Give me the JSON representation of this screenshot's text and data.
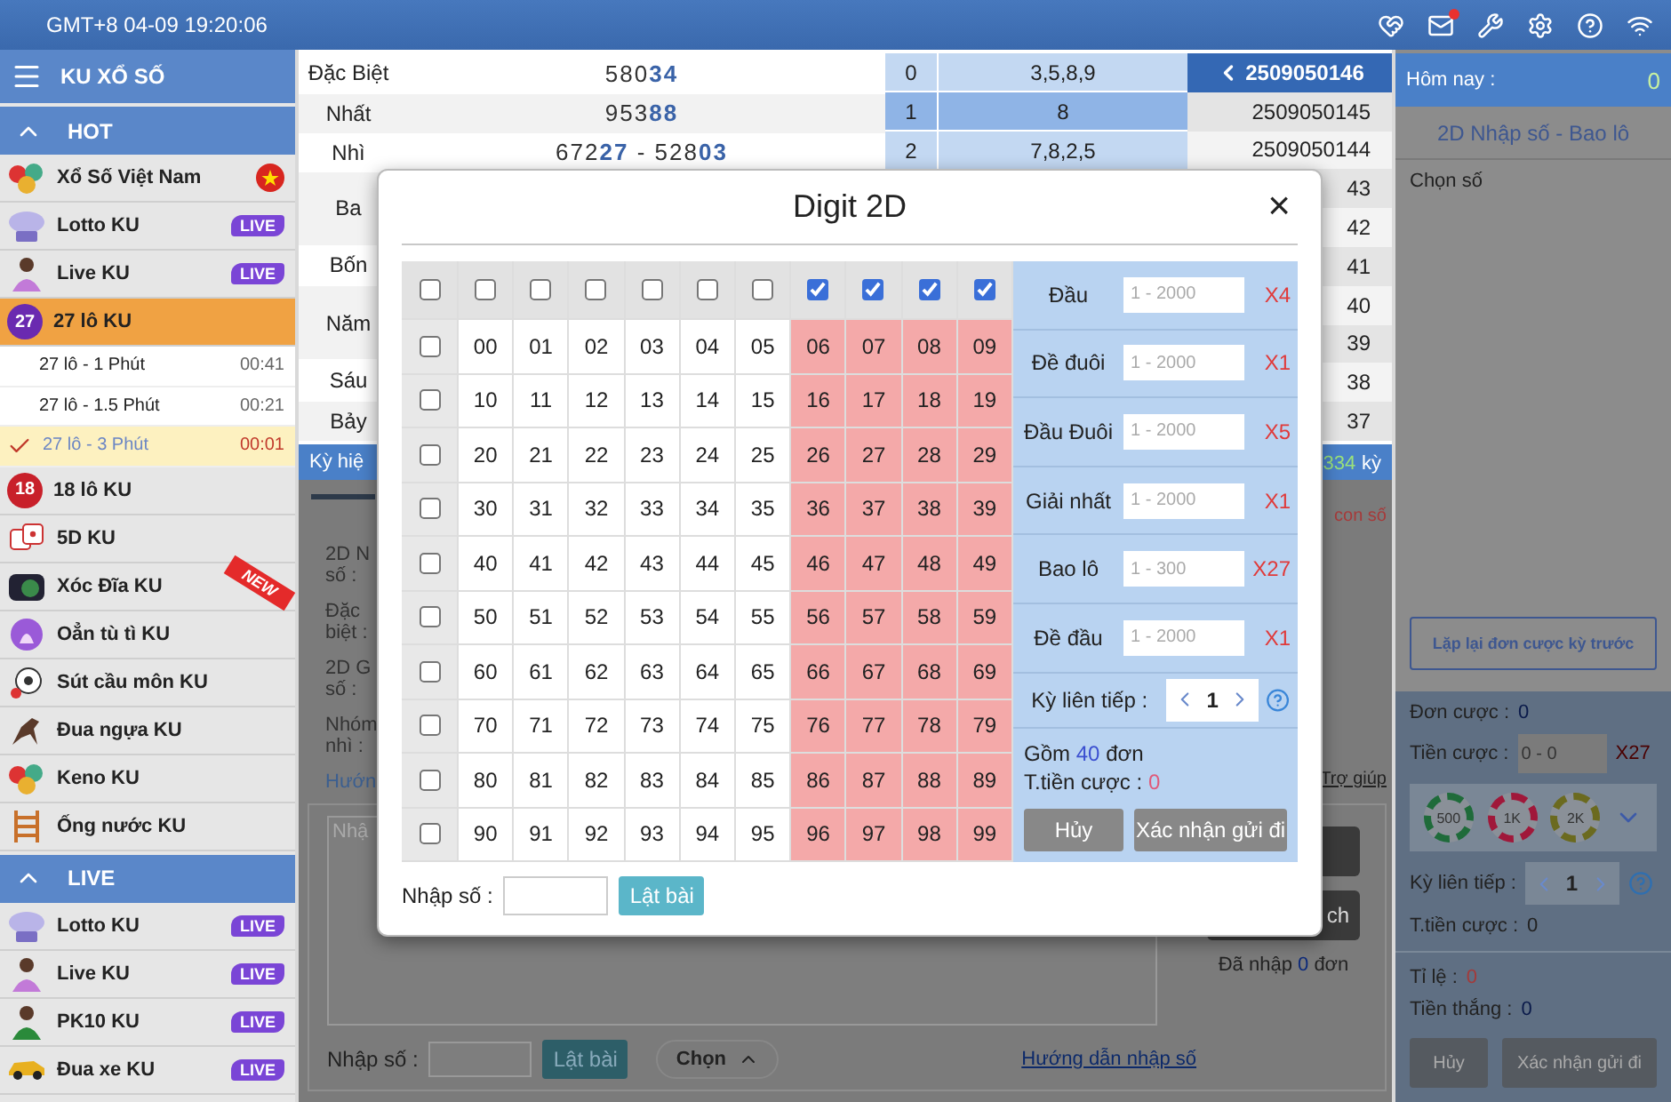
{
  "top_bar": {
    "clock": "GMT+8 04-09 19:20:06",
    "mail_unread": true
  },
  "sidebar": {
    "title": "KU XỔ SỐ",
    "sections": [
      {
        "label": "HOT",
        "expanded": true,
        "items": [
          {
            "label": "Xổ Số Việt Nam",
            "selected": false
          },
          {
            "label": "Lotto KU",
            "selected": false,
            "badge": "LIVE"
          },
          {
            "label": "Live KU",
            "selected": false,
            "badge": "LIVE"
          },
          {
            "label": "27 lô KU",
            "selected": true,
            "emblem": {
              "text": "27",
              "color": "#6a2ab0"
            },
            "children": [
              {
                "label": "27 lô - 1 Phút",
                "time": "00:41",
                "selected": false
              },
              {
                "label": "27 lô - 1.5 Phút",
                "time": "00:21",
                "selected": false
              },
              {
                "label": "27 lô - 3 Phút",
                "time": "00:01",
                "selected": true
              }
            ]
          },
          {
            "label": "18 lô KU",
            "selected": false,
            "emblem": {
              "text": "18",
              "color": "#c8202a"
            }
          },
          {
            "label": "5D KU",
            "selected": false
          },
          {
            "label": "Xóc Đĩa KU",
            "selected": false,
            "ribbon": "NEW"
          },
          {
            "label": "Oẳn tù tì KU",
            "selected": false
          },
          {
            "label": "Sút cầu môn KU",
            "selected": false
          },
          {
            "label": "Đua ngựa KU",
            "selected": false
          },
          {
            "label": "Keno KU",
            "selected": false
          },
          {
            "label": "Ống nước KU",
            "selected": false
          }
        ]
      },
      {
        "label": "LIVE",
        "expanded": true,
        "items": [
          {
            "label": "Lotto KU",
            "selected": false,
            "badge": "LIVE"
          },
          {
            "label": "Live KU",
            "selected": false,
            "badge": "LIVE"
          },
          {
            "label": "PK10 KU",
            "selected": false,
            "badge": "LIVE"
          },
          {
            "label": "Đua xe KU",
            "selected": false,
            "badge": "LIVE"
          }
        ]
      }
    ]
  },
  "results": {
    "prizes": [
      {
        "label": "Đặc Biệt",
        "number": "580**34**"
      },
      {
        "label": "Nhất",
        "number": "953**88**"
      },
      {
        "label": "Nhì",
        "number": "672**27** - 528**03**"
      },
      {
        "label": "Ba"
      },
      {
        "label": "Bốn"
      },
      {
        "label": "Năm"
      },
      {
        "label": "Sáu"
      },
      {
        "label": "Bảy"
      }
    ],
    "digits": [
      {
        "index": "0",
        "values": "3,5,8,9",
        "selected": false
      },
      {
        "index": "1",
        "values": "8",
        "selected": true
      },
      {
        "index": "2",
        "values": "7,8,2,5",
        "selected": false
      }
    ],
    "rounds": [
      {
        "label": "2509050146",
        "selected": true
      },
      {
        "label": "2509050145",
        "selected": false
      },
      {
        "label": "2509050144",
        "selected": false
      },
      {
        "label": "43",
        "selected": false
      },
      {
        "label": "42",
        "selected": false
      },
      {
        "label": "41",
        "selected": false
      },
      {
        "label": "40",
        "selected": false
      },
      {
        "label": "39",
        "selected": false
      },
      {
        "label": "38",
        "selected": false
      },
      {
        "label": "37",
        "selected": false
      }
    ]
  },
  "info_bar": {
    "left": "Kỳ hiệ",
    "count": "334",
    "unit": "kỳ"
  },
  "entry_panel": {
    "labels": [
      {
        "lines": [
          "2D N",
          "số :"
        ]
      },
      {
        "lines": [
          "Đặc",
          "biệt :"
        ]
      },
      {
        "lines": [
          "2D G",
          "số :"
        ]
      },
      {
        "lines": [
          "Nhóm",
          "nhì :"
        ]
      }
    ],
    "guide_link": "Hướn",
    "count_hint": "con số",
    "help_link": "Trợ giúp",
    "textarea_placeholder": "Nhậ",
    "side_button": "ch",
    "entered": {
      "prefix": "Đã nhập",
      "count": "0",
      "suffix": "đơn"
    },
    "input_label": "Nhập số :",
    "flip_button": "Lật bài",
    "choose": "Chọn",
    "guide": "Hướng dẫn nhập số"
  },
  "right_panel": {
    "today_label": "Hôm nay :",
    "today_value": "0",
    "subtitle": "2D Nhập số - Bao lô",
    "pick_label": "Chọn số",
    "repeat_button": "Lặp lại đơn cược kỳ trước",
    "orders_label": "Đơn cược :",
    "orders_value": "0",
    "stake_label": "Tiền cược :",
    "stake_placeholder": "0 - 0",
    "stake_multiplier": "X27",
    "chips": [
      {
        "label": "500",
        "color": "#1f6b3a"
      },
      {
        "label": "1K",
        "color": "#a0183a"
      },
      {
        "label": "2K",
        "color": "#6b6a1f"
      }
    ],
    "streak_label": "Kỳ liên tiếp :",
    "streak_value": "1",
    "total_label": "T.tiền cược :",
    "total_value": "0",
    "ratio_label": "Tỉ lệ :",
    "ratio_value": "0",
    "win_label": "Tiền thắng :",
    "win_value": "0",
    "cancel": "Hủy",
    "confirm": "Xác nhận gửi đi"
  },
  "modal": {
    "title": "Digit 2D",
    "close": "×",
    "corner_checked": false,
    "columns": [
      {
        "checked": false
      },
      {
        "checked": false
      },
      {
        "checked": false
      },
      {
        "checked": false
      },
      {
        "checked": false
      },
      {
        "checked": false
      },
      {
        "checked": true
      },
      {
        "checked": true
      },
      {
        "checked": true
      },
      {
        "checked": true
      }
    ],
    "rows": [
      {
        "checked": false,
        "numbers": [
          "00",
          "01",
          "02",
          "03",
          "04",
          "05",
          "06",
          "07",
          "08",
          "09"
        ]
      },
      {
        "checked": false,
        "numbers": [
          "10",
          "11",
          "12",
          "13",
          "14",
          "15",
          "16",
          "17",
          "18",
          "19"
        ]
      },
      {
        "checked": false,
        "numbers": [
          "20",
          "21",
          "22",
          "23",
          "24",
          "25",
          "26",
          "27",
          "28",
          "29"
        ]
      },
      {
        "checked": false,
        "numbers": [
          "30",
          "31",
          "32",
          "33",
          "34",
          "35",
          "36",
          "37",
          "38",
          "39"
        ]
      },
      {
        "checked": false,
        "numbers": [
          "40",
          "41",
          "42",
          "43",
          "44",
          "45",
          "46",
          "47",
          "48",
          "49"
        ]
      },
      {
        "checked": false,
        "numbers": [
          "50",
          "51",
          "52",
          "53",
          "54",
          "55",
          "56",
          "57",
          "58",
          "59"
        ]
      },
      {
        "checked": false,
        "numbers": [
          "60",
          "61",
          "62",
          "63",
          "64",
          "65",
          "66",
          "67",
          "68",
          "69"
        ]
      },
      {
        "checked": false,
        "numbers": [
          "70",
          "71",
          "72",
          "73",
          "74",
          "75",
          "76",
          "77",
          "78",
          "79"
        ]
      },
      {
        "checked": false,
        "numbers": [
          "80",
          "81",
          "82",
          "83",
          "84",
          "85",
          "86",
          "87",
          "88",
          "89"
        ]
      },
      {
        "checked": false,
        "numbers": [
          "90",
          "91",
          "92",
          "93",
          "94",
          "95",
          "96",
          "97",
          "98",
          "99"
        ]
      }
    ],
    "bets": [
      {
        "label": "Đầu",
        "placeholder": "1 - 2000",
        "multiplier": "X4"
      },
      {
        "label": "Đề đuôi",
        "placeholder": "1 - 2000",
        "multiplier": "X1"
      },
      {
        "label": "Đầu Đuôi",
        "placeholder": "1 - 2000",
        "multiplier": "X5"
      },
      {
        "label": "Giải nhất",
        "placeholder": "1 - 2000",
        "multiplier": "X1"
      },
      {
        "label": "Bao lô",
        "placeholder": "1 - 300",
        "multiplier": "X27"
      },
      {
        "label": "Đề đầu",
        "placeholder": "1 - 2000",
        "multiplier": "X1"
      }
    ],
    "streak_label": "Kỳ liên tiếp :",
    "streak_value": "1",
    "summary": {
      "prefix": "Gồm",
      "count": "40",
      "suffix": "đơn",
      "total_label": "T.tiền cược :",
      "total_value": "0"
    },
    "cancel": "Hủy",
    "confirm": "Xác nhận gửi đi",
    "input_label": "Nhập số :",
    "flip_button": "Lật bài"
  }
}
